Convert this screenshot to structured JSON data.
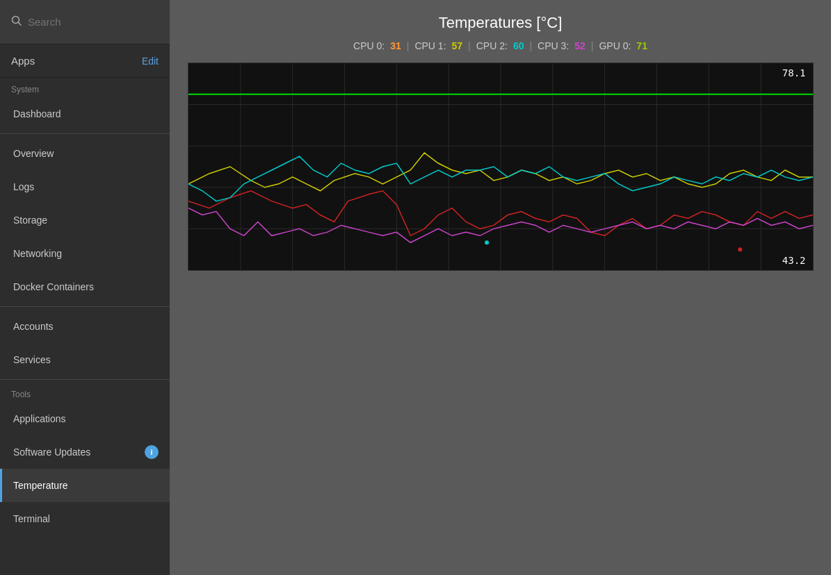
{
  "sidebar": {
    "search_placeholder": "Search",
    "apps_label": "Apps",
    "edit_label": "Edit",
    "system_header": "System",
    "tools_header": "Tools",
    "nav_items": [
      {
        "id": "dashboard",
        "label": "Dashboard",
        "group": "system",
        "active": false
      },
      {
        "id": "overview",
        "label": "Overview",
        "group": "system",
        "active": false
      },
      {
        "id": "logs",
        "label": "Logs",
        "group": "system",
        "active": false
      },
      {
        "id": "storage",
        "label": "Storage",
        "group": "system",
        "active": false
      },
      {
        "id": "networking",
        "label": "Networking",
        "group": "system",
        "active": false
      },
      {
        "id": "docker-containers",
        "label": "Docker Containers",
        "group": "system",
        "active": false
      },
      {
        "id": "accounts",
        "label": "Accounts",
        "group": "system",
        "active": false
      },
      {
        "id": "services",
        "label": "Services",
        "group": "system",
        "active": false
      },
      {
        "id": "applications",
        "label": "Applications",
        "group": "tools",
        "active": false
      },
      {
        "id": "software-updates",
        "label": "Software Updates",
        "group": "tools",
        "active": false,
        "badge": "i"
      },
      {
        "id": "temperature",
        "label": "Temperature",
        "group": "tools",
        "active": true
      },
      {
        "id": "terminal",
        "label": "Terminal",
        "group": "tools",
        "active": false
      }
    ]
  },
  "main": {
    "title": "Temperatures [°C]",
    "cpu_labels": [
      "CPU 0:",
      "CPU 1:",
      "CPU 2:",
      "CPU 3:",
      "GPU 0:"
    ],
    "cpu_values": [
      "31",
      "57",
      "60",
      "52",
      "71"
    ],
    "chart_max": "78.1",
    "chart_min": "43.2"
  },
  "icons": {
    "search": "🔍",
    "info": "i"
  }
}
